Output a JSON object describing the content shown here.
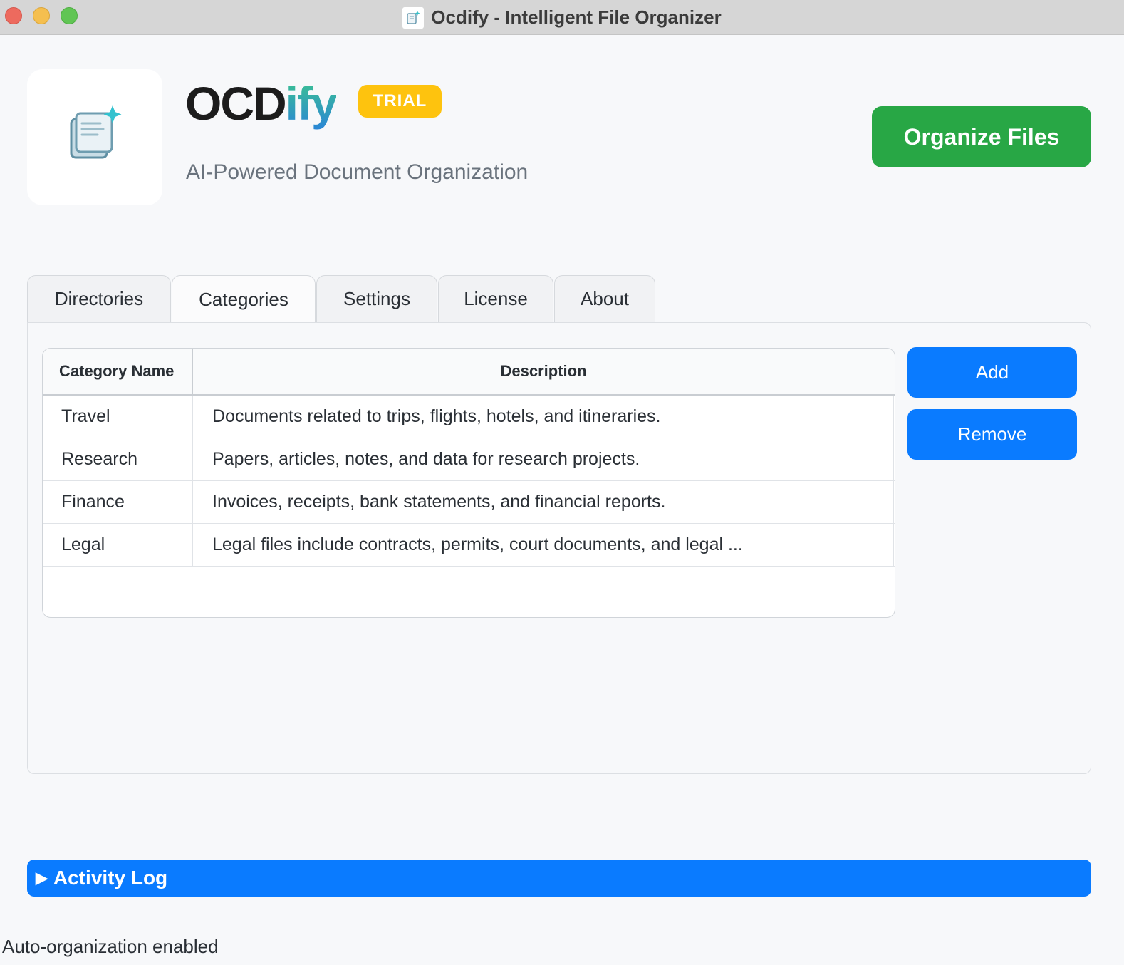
{
  "window": {
    "title": "Ocdify - Intelligent File Organizer"
  },
  "header": {
    "brand_main": "OCD",
    "brand_accent": "ify",
    "badge": "TRIAL",
    "tagline": "AI-Powered Document Organization",
    "organize_label": "Organize Files"
  },
  "tabs": [
    {
      "label": "Directories"
    },
    {
      "label": "Categories"
    },
    {
      "label": "Settings"
    },
    {
      "label": "License"
    },
    {
      "label": "About"
    }
  ],
  "active_tab": "Categories",
  "categories": {
    "columns": {
      "name": "Category Name",
      "description": "Description"
    },
    "rows": [
      {
        "name": "Travel",
        "description": "Documents related to trips, flights, hotels, and itineraries."
      },
      {
        "name": "Research",
        "description": "Papers, articles, notes, and data for research projects."
      },
      {
        "name": "Finance",
        "description": "Invoices, receipts, bank statements, and financial reports."
      },
      {
        "name": "Legal",
        "description": "Legal files include contracts, permits, court documents, and legal ..."
      }
    ],
    "add_label": "Add",
    "remove_label": "Remove"
  },
  "activity_log": {
    "arrow": "▶",
    "label": "Activity Log"
  },
  "status": {
    "text": "Auto-organization enabled"
  },
  "colors": {
    "primary": "#0a7bff",
    "success": "#28a745",
    "badge": "#fec30e"
  },
  "icons": {
    "app": "sparkle-document-icon",
    "expand": "play-triangle-icon"
  }
}
